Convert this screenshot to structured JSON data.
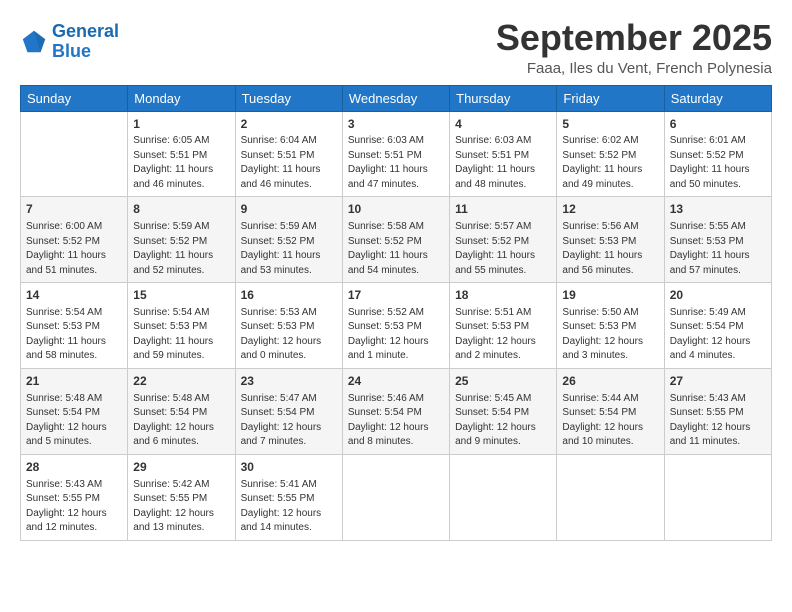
{
  "logo": {
    "line1": "General",
    "line2": "Blue"
  },
  "title": "September 2025",
  "subtitle": "Faaa, Iles du Vent, French Polynesia",
  "header": {
    "save_label": "September 2025",
    "sub_label": "Faaa, Iles du Vent, French Polynesia"
  },
  "weekdays": [
    "Sunday",
    "Monday",
    "Tuesday",
    "Wednesday",
    "Thursday",
    "Friday",
    "Saturday"
  ],
  "weeks": [
    [
      {
        "day": "",
        "info": ""
      },
      {
        "day": "1",
        "info": "Sunrise: 6:05 AM\nSunset: 5:51 PM\nDaylight: 11 hours\nand 46 minutes."
      },
      {
        "day": "2",
        "info": "Sunrise: 6:04 AM\nSunset: 5:51 PM\nDaylight: 11 hours\nand 46 minutes."
      },
      {
        "day": "3",
        "info": "Sunrise: 6:03 AM\nSunset: 5:51 PM\nDaylight: 11 hours\nand 47 minutes."
      },
      {
        "day": "4",
        "info": "Sunrise: 6:03 AM\nSunset: 5:51 PM\nDaylight: 11 hours\nand 48 minutes."
      },
      {
        "day": "5",
        "info": "Sunrise: 6:02 AM\nSunset: 5:52 PM\nDaylight: 11 hours\nand 49 minutes."
      },
      {
        "day": "6",
        "info": "Sunrise: 6:01 AM\nSunset: 5:52 PM\nDaylight: 11 hours\nand 50 minutes."
      }
    ],
    [
      {
        "day": "7",
        "info": "Sunrise: 6:00 AM\nSunset: 5:52 PM\nDaylight: 11 hours\nand 51 minutes."
      },
      {
        "day": "8",
        "info": "Sunrise: 5:59 AM\nSunset: 5:52 PM\nDaylight: 11 hours\nand 52 minutes."
      },
      {
        "day": "9",
        "info": "Sunrise: 5:59 AM\nSunset: 5:52 PM\nDaylight: 11 hours\nand 53 minutes."
      },
      {
        "day": "10",
        "info": "Sunrise: 5:58 AM\nSunset: 5:52 PM\nDaylight: 11 hours\nand 54 minutes."
      },
      {
        "day": "11",
        "info": "Sunrise: 5:57 AM\nSunset: 5:52 PM\nDaylight: 11 hours\nand 55 minutes."
      },
      {
        "day": "12",
        "info": "Sunrise: 5:56 AM\nSunset: 5:53 PM\nDaylight: 11 hours\nand 56 minutes."
      },
      {
        "day": "13",
        "info": "Sunrise: 5:55 AM\nSunset: 5:53 PM\nDaylight: 11 hours\nand 57 minutes."
      }
    ],
    [
      {
        "day": "14",
        "info": "Sunrise: 5:54 AM\nSunset: 5:53 PM\nDaylight: 11 hours\nand 58 minutes."
      },
      {
        "day": "15",
        "info": "Sunrise: 5:54 AM\nSunset: 5:53 PM\nDaylight: 11 hours\nand 59 minutes."
      },
      {
        "day": "16",
        "info": "Sunrise: 5:53 AM\nSunset: 5:53 PM\nDaylight: 12 hours\nand 0 minutes."
      },
      {
        "day": "17",
        "info": "Sunrise: 5:52 AM\nSunset: 5:53 PM\nDaylight: 12 hours\nand 1 minute."
      },
      {
        "day": "18",
        "info": "Sunrise: 5:51 AM\nSunset: 5:53 PM\nDaylight: 12 hours\nand 2 minutes."
      },
      {
        "day": "19",
        "info": "Sunrise: 5:50 AM\nSunset: 5:53 PM\nDaylight: 12 hours\nand 3 minutes."
      },
      {
        "day": "20",
        "info": "Sunrise: 5:49 AM\nSunset: 5:54 PM\nDaylight: 12 hours\nand 4 minutes."
      }
    ],
    [
      {
        "day": "21",
        "info": "Sunrise: 5:48 AM\nSunset: 5:54 PM\nDaylight: 12 hours\nand 5 minutes."
      },
      {
        "day": "22",
        "info": "Sunrise: 5:48 AM\nSunset: 5:54 PM\nDaylight: 12 hours\nand 6 minutes."
      },
      {
        "day": "23",
        "info": "Sunrise: 5:47 AM\nSunset: 5:54 PM\nDaylight: 12 hours\nand 7 minutes."
      },
      {
        "day": "24",
        "info": "Sunrise: 5:46 AM\nSunset: 5:54 PM\nDaylight: 12 hours\nand 8 minutes."
      },
      {
        "day": "25",
        "info": "Sunrise: 5:45 AM\nSunset: 5:54 PM\nDaylight: 12 hours\nand 9 minutes."
      },
      {
        "day": "26",
        "info": "Sunrise: 5:44 AM\nSunset: 5:54 PM\nDaylight: 12 hours\nand 10 minutes."
      },
      {
        "day": "27",
        "info": "Sunrise: 5:43 AM\nSunset: 5:55 PM\nDaylight: 12 hours\nand 11 minutes."
      }
    ],
    [
      {
        "day": "28",
        "info": "Sunrise: 5:43 AM\nSunset: 5:55 PM\nDaylight: 12 hours\nand 12 minutes."
      },
      {
        "day": "29",
        "info": "Sunrise: 5:42 AM\nSunset: 5:55 PM\nDaylight: 12 hours\nand 13 minutes."
      },
      {
        "day": "30",
        "info": "Sunrise: 5:41 AM\nSunset: 5:55 PM\nDaylight: 12 hours\nand 14 minutes."
      },
      {
        "day": "",
        "info": ""
      },
      {
        "day": "",
        "info": ""
      },
      {
        "day": "",
        "info": ""
      },
      {
        "day": "",
        "info": ""
      }
    ]
  ]
}
